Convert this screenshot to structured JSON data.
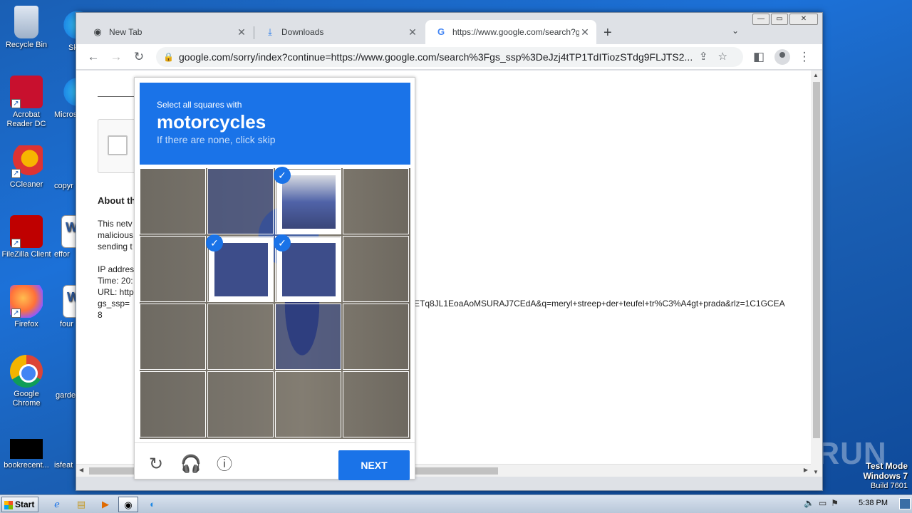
{
  "desktop": {
    "icons": [
      {
        "label": "Recycle Bin",
        "icon": "recycle-bin-icon"
      },
      {
        "label": "Acrobat Reader DC",
        "icon": "acrobat-icon"
      },
      {
        "label": "CCleaner",
        "icon": "ccleaner-icon"
      },
      {
        "label": "FileZilla Client",
        "icon": "filezilla-icon"
      },
      {
        "label": "Firefox",
        "icon": "firefox-icon"
      },
      {
        "label": "Google Chrome",
        "icon": "chrome-icon"
      },
      {
        "label": "bookrecent...",
        "icon": "file-icon"
      },
      {
        "label": "Sk",
        "icon": "skype-icon"
      },
      {
        "label": "Micros",
        "icon": "edge-icon"
      },
      {
        "label": "copyr",
        "icon": "word-icon"
      },
      {
        "label": "effor",
        "icon": "word-icon"
      },
      {
        "label": "four",
        "icon": "word-icon"
      },
      {
        "label": "garde",
        "icon": "word-icon"
      },
      {
        "label": "isfeat",
        "icon": "word-icon"
      }
    ]
  },
  "browser": {
    "tabs": [
      {
        "title": "New Tab",
        "icon": "chrome-icon"
      },
      {
        "title": "Downloads",
        "icon": "download-icon"
      },
      {
        "title": "https://www.google.com/search?gs",
        "icon": "google-icon"
      }
    ],
    "address": "google.com/sorry/index?continue=https://www.google.com/search%3Fgs_ssp%3DeJzj4tTP1TdITiozSTdg9FLJTS2..."
  },
  "page": {
    "heading": "About th",
    "para": [
      "This netv",
      "malicious",
      "sending t"
    ],
    "ip_lines": [
      "IP addres",
      "Time: 20:",
      "URL: http",
      "gs_ssp="
    ],
    "url_tail": "ETq8JL1EoaAoMSURAJ7CEdA&q=meryl+streep+der+teufel+tr%C3%A4gt+prada&rlz=1C1GCEA",
    "last_line": "8"
  },
  "captcha": {
    "instruction": "Select all squares with",
    "target": "motorcycles",
    "hint": "If there are none, click skip",
    "selected_tiles": [
      2,
      5,
      6
    ],
    "next_label": "NEXT"
  },
  "watermark": "ANY RUN",
  "test_mode": {
    "line1": "Test Mode",
    "line2": "Windows 7",
    "line3": "Build 7601"
  },
  "taskbar": {
    "start_label": "Start",
    "clock": "5:38 PM"
  }
}
